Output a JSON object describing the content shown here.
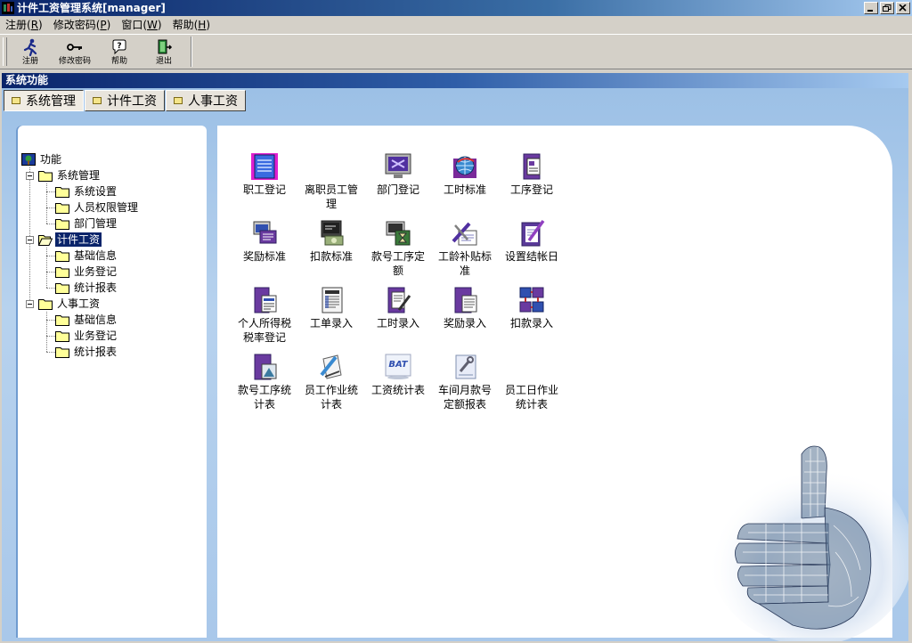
{
  "window": {
    "title": "计件工资管理系统[manager]"
  },
  "menu": [
    {
      "label": "注册(",
      "key": "R",
      "end": ")"
    },
    {
      "label": "修改密码(",
      "key": "P",
      "end": ")"
    },
    {
      "label": "窗口(",
      "key": "W",
      "end": ")"
    },
    {
      "label": "帮助(",
      "key": "H",
      "end": ")"
    }
  ],
  "toolbar": {
    "register": "注册",
    "change_password": "修改密码",
    "help": "帮助",
    "exit": "退出"
  },
  "panel_title": "系统功能",
  "tabs": [
    "系统管理",
    "计件工资",
    "人事工资"
  ],
  "tree": {
    "root": "功能",
    "groups": [
      {
        "label": "系统管理",
        "children": [
          "系统设置",
          "人员权限管理",
          "部门管理"
        ]
      },
      {
        "label": "计件工资",
        "children": [
          "基础信息",
          "业务登记",
          "统计报表"
        ]
      },
      {
        "label": "人事工资",
        "children": [
          "基础信息",
          "业务登记",
          "统计报表"
        ]
      }
    ]
  },
  "icons": [
    {
      "line1": "职工登记",
      "line2": "",
      "icon": "document-icon"
    },
    {
      "line1": "离职员工管",
      "line2": "理",
      "icon": "blank-icon"
    },
    {
      "line1": "部门登记",
      "line2": "",
      "icon": "monitor-icon"
    },
    {
      "line1": "工时标准",
      "line2": "",
      "icon": "globe-icon"
    },
    {
      "line1": "工序登记",
      "line2": "",
      "icon": "book-icon"
    },
    {
      "line1": "奖励标准",
      "line2": "",
      "icon": "windows-icon"
    },
    {
      "line1": "扣款标准",
      "line2": "",
      "icon": "computer-icon"
    },
    {
      "line1": "款号工序定",
      "line2": "额",
      "icon": "hourglass-icon"
    },
    {
      "line1": "工龄补贴标",
      "line2": "准",
      "icon": "tools-icon"
    },
    {
      "line1": "设置结帐日",
      "line2": "",
      "icon": "pen-book-icon"
    },
    {
      "line1": "个人所得税",
      "line2": "税率登记",
      "icon": "book-sheet-icon"
    },
    {
      "line1": "工单录入",
      "line2": "",
      "icon": "form-icon"
    },
    {
      "line1": "工时录入",
      "line2": "",
      "icon": "book-pen-icon"
    },
    {
      "line1": "奖励录入",
      "line2": "",
      "icon": "book-doc-icon"
    },
    {
      "line1": "扣款录入",
      "line2": "",
      "icon": "network-icon"
    },
    {
      "line1": "款号工序统",
      "line2": "计表",
      "icon": "book-chart-icon"
    },
    {
      "line1": "员工作业统",
      "line2": "计表",
      "icon": "pen-paper-icon"
    },
    {
      "line1": "工资统计表",
      "line2": "",
      "icon": "bat-icon"
    },
    {
      "line1": "车间月款号",
      "line2": "定额报表",
      "icon": "wrench-paper-icon"
    },
    {
      "line1": "员工日作业",
      "line2": "统计表",
      "icon": "blank-icon"
    }
  ]
}
